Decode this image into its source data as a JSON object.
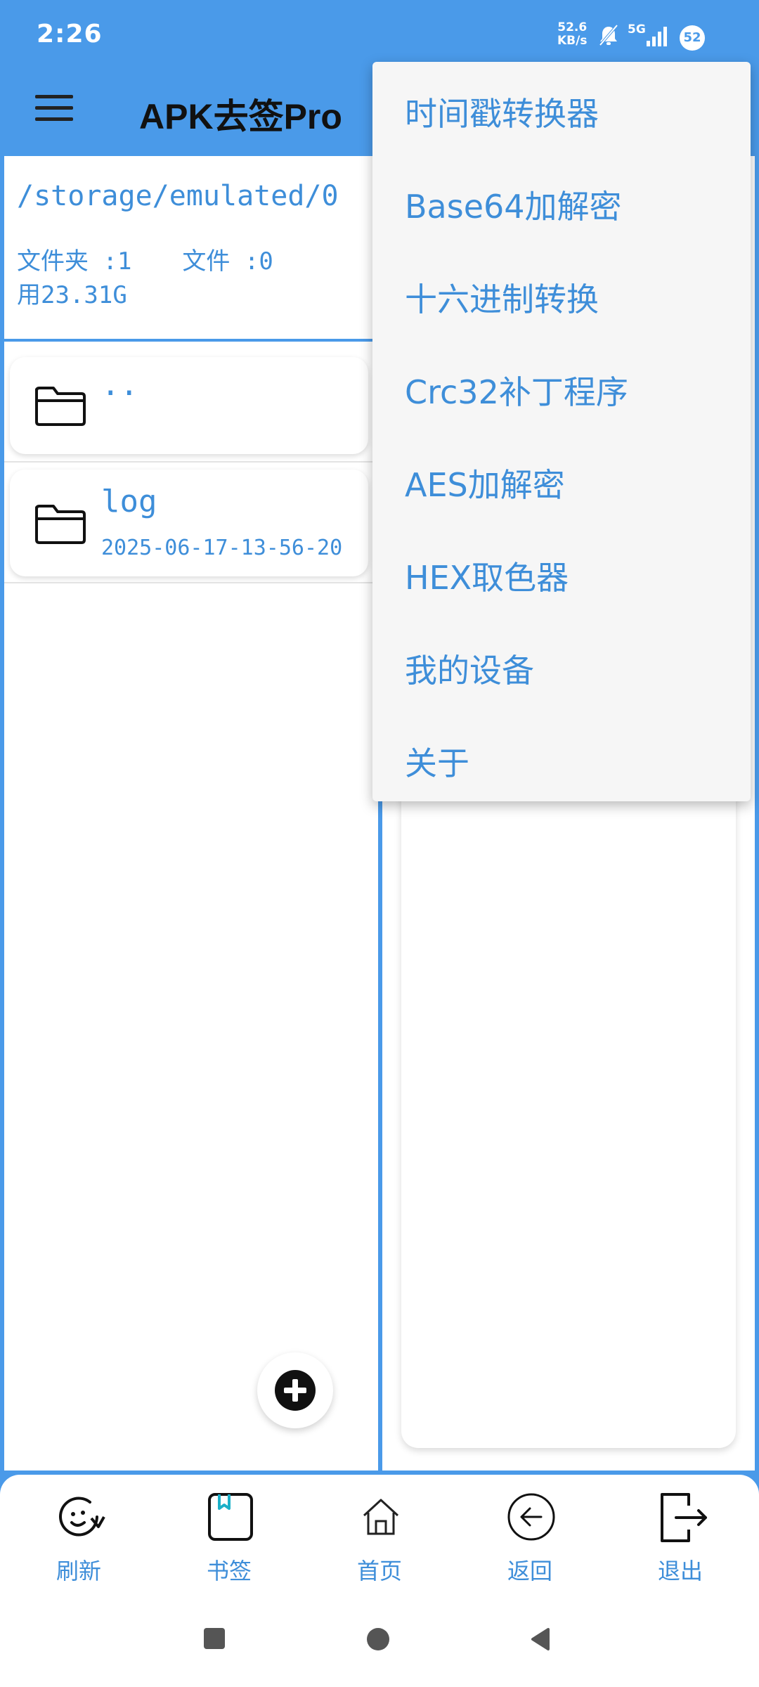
{
  "status_bar": {
    "time": "2:26",
    "net_speed_value": "52.6",
    "net_speed_unit": "KB/s",
    "network_type": "5G",
    "battery": "52",
    "icons": [
      "mute-bell-icon",
      "signal-icon"
    ]
  },
  "app_bar": {
    "title": "APK去签Pro",
    "menu_icon": "hamburger-menu-icon"
  },
  "file_browser": {
    "path": "/storage/emulated/0",
    "folder_count_label": "文件夹 :1",
    "file_count_label": "文件 :0",
    "storage_label": "用23.31G",
    "items": [
      {
        "name": "..",
        "date": "",
        "icon": "folder-icon"
      },
      {
        "name": "log",
        "date": "2025-06-17-13-56-20",
        "icon": "folder-icon"
      }
    ]
  },
  "popup_menu": {
    "items": [
      {
        "label": "时间戳转换器"
      },
      {
        "label": "Base64加解密"
      },
      {
        "label": "十六进制转换"
      },
      {
        "label": "Crc32补丁程序"
      },
      {
        "label": "AES加解密"
      },
      {
        "label": "HEX取色器"
      },
      {
        "label": "我的设备"
      },
      {
        "label": "关于"
      }
    ]
  },
  "bottom_nav": {
    "items": [
      {
        "label": "刷新",
        "icon": "refresh-icon"
      },
      {
        "label": "书签",
        "icon": "bookmark-icon"
      },
      {
        "label": "首页",
        "icon": "home-icon"
      },
      {
        "label": "返回",
        "icon": "back-icon"
      },
      {
        "label": "退出",
        "icon": "exit-icon"
      }
    ]
  },
  "colors": {
    "primary": "#4a9ae9",
    "text_accent": "#3e8ed9",
    "surface": "#ffffff",
    "menu_bg": "#f6f6f6"
  }
}
